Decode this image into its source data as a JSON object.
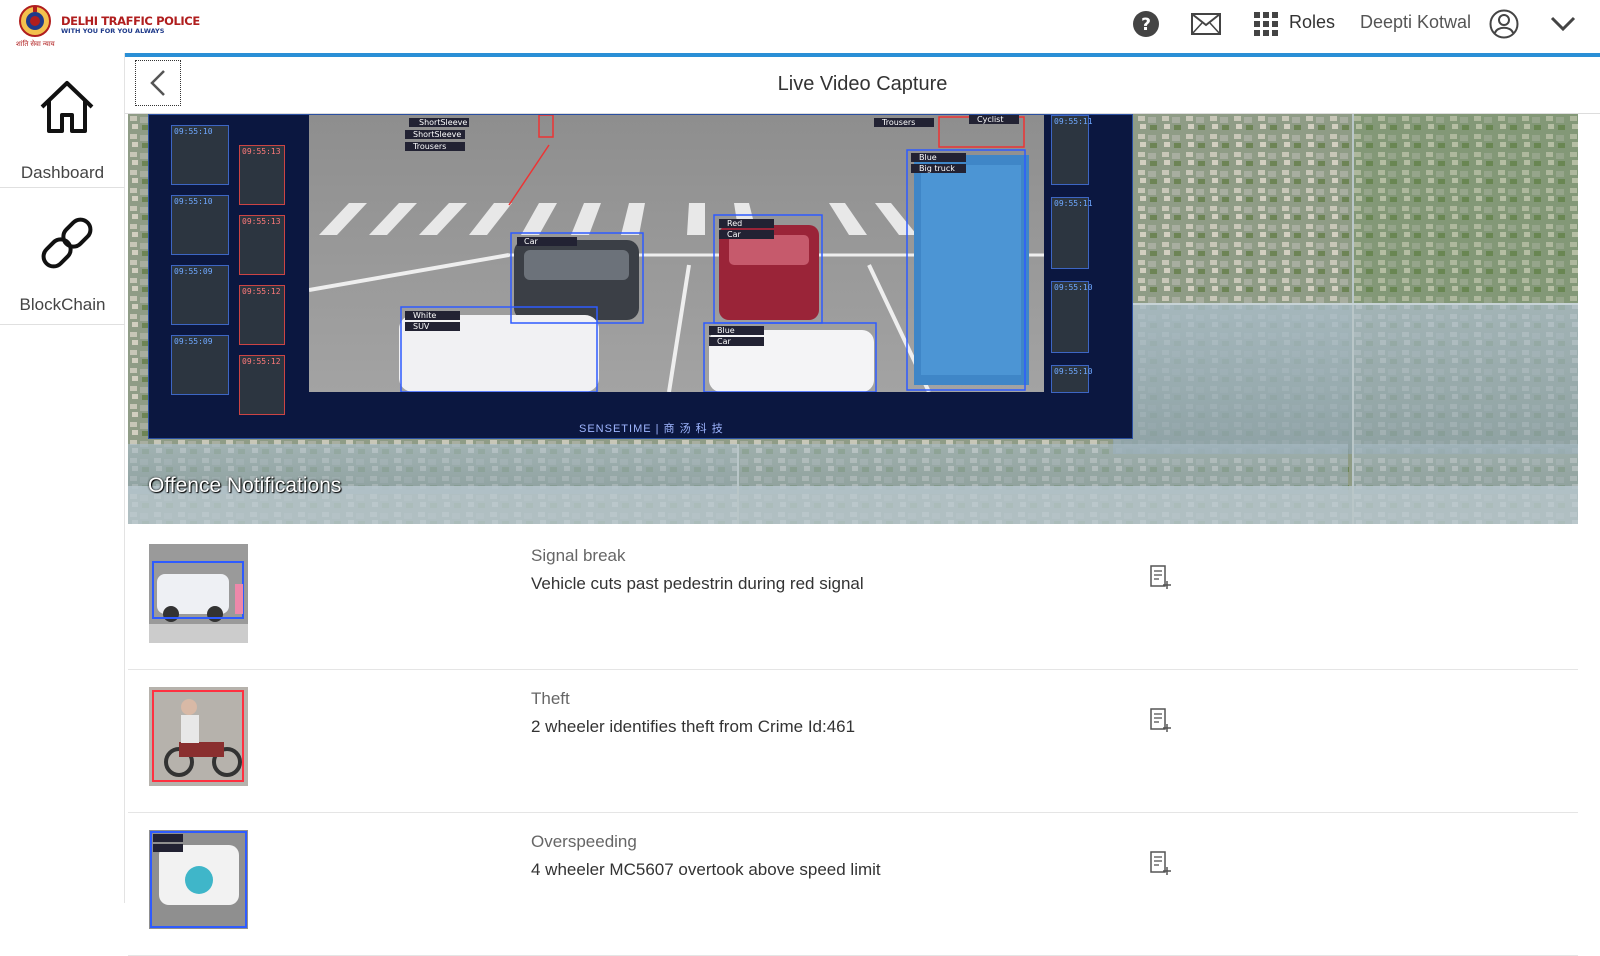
{
  "header": {
    "logo_title": "DELHI TRAFFIC POLICE",
    "logo_tagline": "WITH YOU FOR YOU ALWAYS",
    "logo_motto": "शांति सेवा न्याय",
    "roles_label": "Roles",
    "user_name": "Deepti Kotwal",
    "icons": [
      "help-icon",
      "mail-icon",
      "apps-grid-icon",
      "account-icon",
      "chevron-down-icon"
    ]
  },
  "sidebar": {
    "items": [
      {
        "label": "Dashboard",
        "icon": "home-icon"
      },
      {
        "label": "BlockChain",
        "icon": "link-icon"
      }
    ]
  },
  "page": {
    "title": "Live Video Capture",
    "back_icon": "chevron-left-icon"
  },
  "video": {
    "brand": "SENSETIME | 商 汤 科 技",
    "left_thumbs": [
      "09:55:10",
      "09:55:10",
      "09:55:09",
      "09:55:09"
    ],
    "mid_thumbs": [
      "09:55:13",
      "09:55:13",
      "09:55:12",
      "09:55:12"
    ],
    "right_thumbs": [
      "09:55:11",
      "09:55:11",
      "09:55:10",
      "09:55:10"
    ],
    "labels": {
      "shortsleeve1": "ShortSleeve",
      "shortsleeve2": "ShortSleeve",
      "trousers1": "Trousers",
      "trousers2": "Trousers",
      "cyclist": "Cyclist",
      "car1": "Car",
      "red": "Red",
      "car2": "Car",
      "blue1": "Blue",
      "bigtruck": "Big truck",
      "white": "White",
      "suv": "SUV",
      "blue2": "Blue",
      "car3": "Car"
    },
    "section_title": "Offence Notifications"
  },
  "notifications": [
    {
      "type": "Signal break",
      "description": "Vehicle cuts past pedestrin during red signal",
      "action_icon": "add-note-icon"
    },
    {
      "type": "Theft",
      "description": "2 wheeler identifies theft from Crime Id:461",
      "action_icon": "add-note-icon"
    },
    {
      "type": "Overspeeding",
      "description": "4 wheeler MC5607 overtook above speed limit",
      "action_icon": "add-note-icon"
    }
  ],
  "colors": {
    "accent": "#2a8fd6",
    "brand_red": "#b01e1e",
    "detect_box": "#2e5bff"
  }
}
